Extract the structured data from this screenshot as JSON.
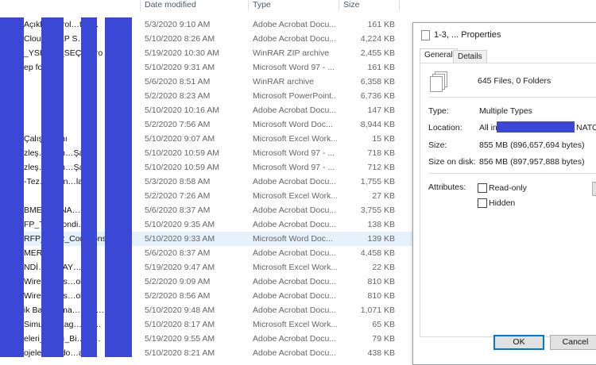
{
  "explorer": {
    "columns": {
      "date": "Date modified",
      "type": "Type",
      "size": "Size"
    },
    "rows": [
      {
        "name": "Açıkl…ontrol…tes…",
        "date": "5/3/2020 9:10 AM",
        "type": "Adobe Acrobat Docu...",
        "size": "161 KB"
      },
      {
        "name": "Cloud…ALP S…m",
        "date": "5/10/2020 8:26 AM",
        "type": "Adobe Acrobat Docu...",
        "size": "4,224 KB"
      },
      {
        "name": "_YSK…D_SEÇ…Pro",
        "date": "5/19/2020 10:30 AM",
        "type": "WinRAR ZIP archive",
        "size": "2,455 KB"
      },
      {
        "name": "ep fo…",
        "date": "5/10/2020 9:31 AM",
        "type": "Microsoft Word 97 - ...",
        "size": "161 KB"
      },
      {
        "name": "",
        "date": "5/6/2020 8:51 AM",
        "type": "WinRAR archive",
        "size": "6,358 KB"
      },
      {
        "name": "",
        "date": "5/2/2020 8:23 AM",
        "type": "Microsoft PowerPoint...",
        "size": "6,736 KB"
      },
      {
        "name": "",
        "date": "5/10/2020 10:16 AM",
        "type": "Adobe Acrobat Docu...",
        "size": "147 KB"
      },
      {
        "name": "",
        "date": "5/2/2020 7:56 AM",
        "type": "Microsoft Word Doc...",
        "size": "8,944 KB"
      },
      {
        "name": "Çalışm…ını",
        "date": "5/10/2020 9:07 AM",
        "type": "Microsoft Excel Work...",
        "size": "15 KB"
      },
      {
        "name": "zleş…ükün…Şa",
        "date": "5/10/2020 10:59 AM",
        "type": "Microsoft Word 97 - ...",
        "size": "718 KB"
      },
      {
        "name": "zleş…ükün…Şa",
        "date": "5/10/2020 10:59 AM",
        "type": "Microsoft Word 97 - ...",
        "size": "712 KB"
      },
      {
        "name": "-Tez…-Stan…ları",
        "date": "5/3/2020 8:58 AM",
        "type": "Adobe Acrobat Docu...",
        "size": "1,755 KB"
      },
      {
        "name": "",
        "date": "5/2/2020 7:26 AM",
        "type": "Microsoft Excel Work...",
        "size": "27 KB"
      },
      {
        "name": "BME…ELNA…",
        "date": "5/6/2020 8:37 AM",
        "type": "Adobe Acrobat Docu...",
        "size": "3,755 KB"
      },
      {
        "name": "FP_Te…Condi…s (",
        "date": "5/10/2020 9:35 AM",
        "type": "Adobe Acrobat Docu...",
        "size": "138 KB"
      },
      {
        "name": "RFP_T…R_Con…ons …",
        "date": "5/10/2020 9:33 AM",
        "type": "Microsoft Word Doc...",
        "size": "139 KB",
        "selected": true
      },
      {
        "name": "MER…",
        "date": "5/6/2020 8:37 AM",
        "type": "Adobe Acrobat Docu...",
        "size": "4,458 KB"
      },
      {
        "name": "NDİ…DETAY…",
        "date": "5/19/2020 9:47 AM",
        "type": "Microsoft Excel Work...",
        "size": "22 KB"
      },
      {
        "name": "Wire…le As…oly…",
        "date": "5/2/2020 9:09 AM",
        "type": "Adobe Acrobat Docu...",
        "size": "810 KB"
      },
      {
        "name": "Wire…le As…oly…",
        "date": "5/2/2020 8:56 AM",
        "type": "Adobe Acrobat Docu...",
        "size": "810 KB"
      },
      {
        "name": "ik Ba…forma…Değ…",
        "date": "5/10/2020 9:48 AM",
        "type": "Adobe Acrobat Docu...",
        "size": "1,071 KB"
      },
      {
        "name": "Simu…ackag…Inc…",
        "date": "5/10/2020 8:17 AM",
        "type": "Microsoft Excel Work...",
        "size": "65 KB"
      },
      {
        "name": "eleri_…Yılı_Bi…Si…",
        "date": "5/19/2020 9:55 AM",
        "type": "Adobe Acrobat Docu...",
        "size": "79 KB"
      },
      {
        "name": "ojele…ec do…ani…",
        "date": "5/10/2020 8:21 AM",
        "type": "Adobe Acrobat Docu...",
        "size": "438 KB"
      }
    ]
  },
  "dialog": {
    "title": "1-3, ... Properties",
    "tabs": [
      "General",
      "Details"
    ],
    "summary": "645 Files, 0 Folders",
    "type_label": "Type:",
    "type_value": "Multiple Types",
    "location_label": "Location:",
    "location_prefix": "All in",
    "location_suffix": "NATOV",
    "size_label": "Size:",
    "size_value": "855 MB (896,657,694 bytes)",
    "size_on_disk_label": "Size on disk:",
    "size_on_disk_value": "856 MB (897,957,888 bytes)",
    "attributes_label": "Attributes:",
    "readonly_label": "Read-only",
    "hidden_label": "Hidden",
    "ok_label": "OK",
    "cancel_label": "Cancel"
  },
  "colors": {
    "redaction": "#3b48d6",
    "selection": "#e5f1fb",
    "ok_border": "#0078d7"
  }
}
